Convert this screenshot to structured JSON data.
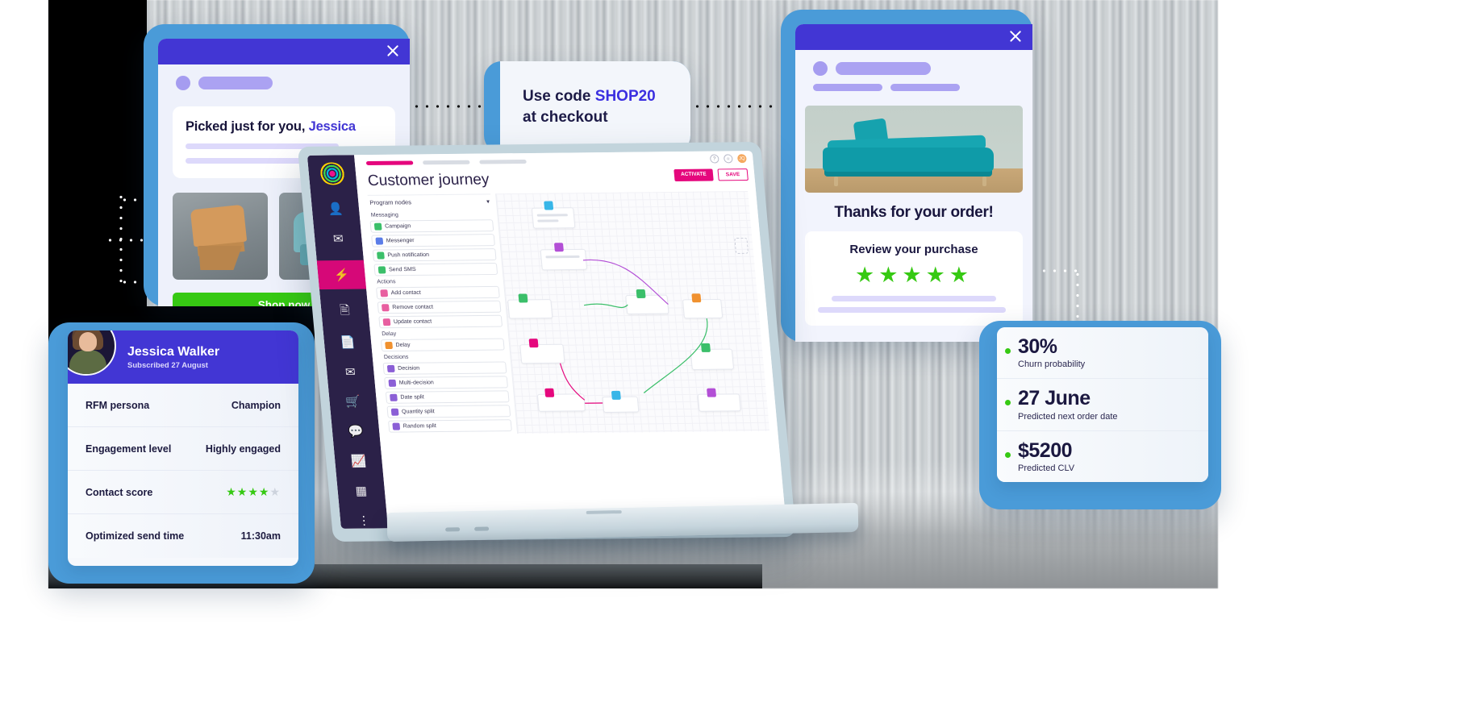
{
  "email_panel": {
    "close_icon": "close-icon",
    "headline_prefix": "Picked just for you, ",
    "headline_name": "Jessica",
    "cta_label": "Shop now"
  },
  "promo_bubble": {
    "line1_prefix": "Use code ",
    "line1_code": "SHOP20",
    "line2": "at checkout"
  },
  "order_panel": {
    "close_icon": "close-icon",
    "title": "Thanks for your order!",
    "review_title": "Review your purchase",
    "stars": "★★★★★",
    "star_count": 5
  },
  "profile_card": {
    "name": "Jessica Walker",
    "subscribed": "Subscribed 27 August",
    "rows": [
      {
        "key": "RFM persona",
        "value": "Champion",
        "type": "text"
      },
      {
        "key": "Engagement level",
        "value": "Highly engaged",
        "type": "text"
      },
      {
        "key": "Contact score",
        "value": "",
        "type": "stars",
        "filled": 4,
        "total": 5
      },
      {
        "key": "Optimized send time",
        "value": "11:30am",
        "type": "text"
      }
    ]
  },
  "metrics_card": {
    "metrics": [
      {
        "value": "30%",
        "label": "Churn probability"
      },
      {
        "value": "27 June",
        "label": "Predicted next order date"
      },
      {
        "value": "$5200",
        "label": "Predicted CLV"
      }
    ]
  },
  "laptop": {
    "app_title": "Customer journey",
    "panel_header": "Program nodes",
    "chevron_icon": "chevron-down-icon",
    "groups": [
      {
        "group": "Messaging",
        "items": [
          {
            "label": "Campaign",
            "icon": "campaign-icon",
            "color": "#3bbf6a"
          },
          {
            "label": "Messenger",
            "icon": "messenger-icon",
            "color": "#5b7de8"
          },
          {
            "label": "Push notification",
            "icon": "push-icon",
            "color": "#3bbf6a"
          },
          {
            "label": "Send SMS",
            "icon": "sms-icon",
            "color": "#3bbf6a"
          }
        ]
      },
      {
        "group": "Actions",
        "items": [
          {
            "label": "Add contact",
            "icon": "add-contact-icon",
            "color": "#e85fa0"
          },
          {
            "label": "Remove contact",
            "icon": "remove-contact-icon",
            "color": "#e85fa0"
          },
          {
            "label": "Update contact",
            "icon": "update-contact-icon",
            "color": "#e85fa0"
          }
        ]
      },
      {
        "group": "Delay",
        "items": [
          {
            "label": "Delay",
            "icon": "clock-icon",
            "color": "#f0912f"
          }
        ]
      },
      {
        "group": "Decisions",
        "items": [
          {
            "label": "Decision",
            "icon": "decision-icon",
            "color": "#8b5fd6"
          },
          {
            "label": "Multi-decision",
            "icon": "multi-decision-icon",
            "color": "#8b5fd6"
          },
          {
            "label": "Date split",
            "icon": "date-split-icon",
            "color": "#8b5fd6"
          },
          {
            "label": "Quantity split",
            "icon": "quantity-split-icon",
            "color": "#8b5fd6"
          },
          {
            "label": "Random split",
            "icon": "random-split-icon",
            "color": "#8b5fd6"
          }
        ]
      }
    ],
    "toolbar": {
      "activate_label": "ACTIVATE",
      "save_label": "SAVE",
      "help_icon": "help-icon",
      "notification_icon": "bell-icon",
      "avatar_initials": "JQ"
    },
    "sidebar_icons": [
      "logo-icon",
      "contacts-icon",
      "email-icon",
      "automation-icon",
      "content-icon",
      "forms-icon",
      "transactional-email-icon",
      "ecommerce-icon",
      "chat-icon",
      "analytics-icon",
      "apps-icon",
      "more-icon"
    ]
  },
  "colors": {
    "brand_blue": "#4a9bd8",
    "purple": "#4236d4",
    "accent_pink": "#e5077d",
    "green": "#36c913",
    "dark_navy": "#2b2148"
  }
}
